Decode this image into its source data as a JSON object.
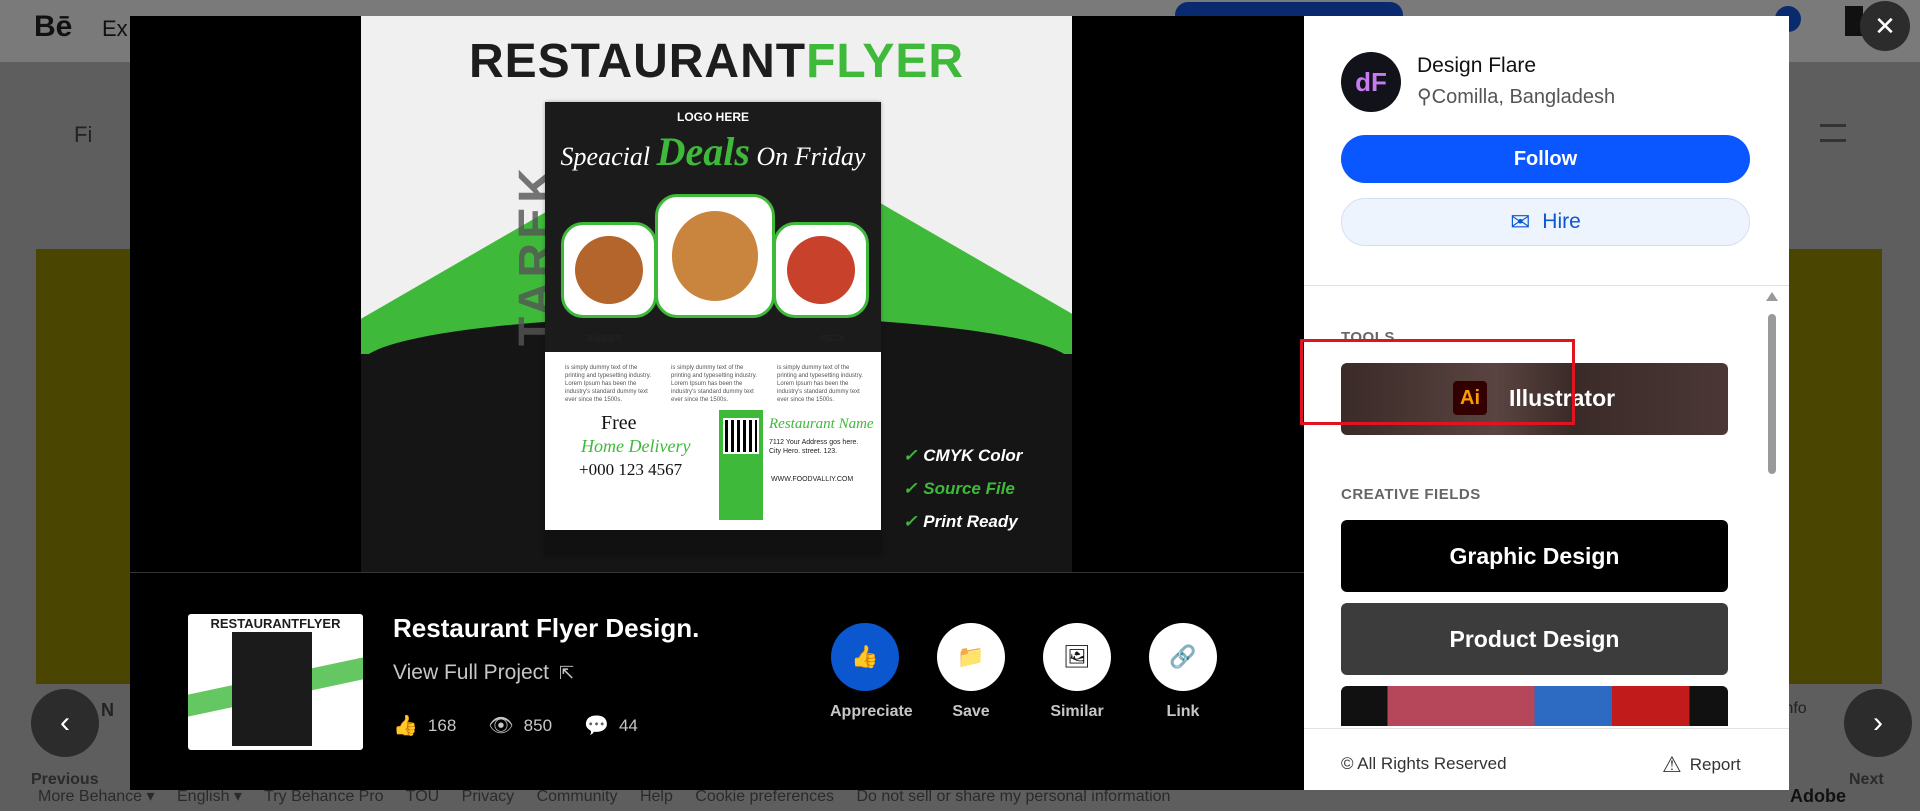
{
  "background": {
    "logo": "Bē",
    "explore": "Ex",
    "filter_label": "Fi",
    "card_label": "d. N",
    "info": "Info",
    "footer_links": [
      "More Behance ▾",
      "English ▾",
      "Try Behance Pro",
      "TOU",
      "Privacy",
      "Community",
      "Help",
      "Cookie preferences",
      "Do not sell or share my personal information"
    ],
    "footer_brand": "Adobe"
  },
  "close_icon": "✕",
  "flyer": {
    "title_part1": "RESTAURANT",
    "title_part2": "FLYER",
    "logo_here": "LOGO HERE",
    "headline_pre": "Speacial",
    "headline_deals": "Deals",
    "headline_post": "On Friday",
    "food_labels": [
      "BURGER",
      "PIZZA"
    ],
    "body_text": "is simply dummy text of the printing and typesetting industry. Lorem Ipsum has been the industry's standard dummy text ever since the 1500s.",
    "free": "Free",
    "home_delivery": "Home Delivery",
    "phone": "+000 123 4567",
    "restaurant_name": "Restaurant Name",
    "address": "7112 Your Address gos here. City Hero. street. 123.",
    "url": "WWW.FOODVALLIY.COM",
    "watermark": "TAREK",
    "features": [
      {
        "text": "CMYK Color",
        "green": false
      },
      {
        "text": "Source File",
        "green": true
      },
      {
        "text": "Print Ready",
        "green": false
      }
    ]
  },
  "project": {
    "thumb_title": "RESTAURANTFLYER",
    "title": "Restaurant Flyer Design.",
    "view_full": "View Full Project",
    "external_icon": "external-link-icon",
    "stats": {
      "appreciations": "168",
      "views": "850",
      "comments": "44"
    },
    "actions": [
      {
        "label": "Appreciate",
        "icon": "thumbs-up-icon"
      },
      {
        "label": "Save",
        "icon": "folder-icon"
      },
      {
        "label": "Similar",
        "icon": "image-icon"
      },
      {
        "label": "Link",
        "icon": "link-icon"
      }
    ]
  },
  "owner": {
    "avatar_initials": "dF",
    "name": "Design Flare",
    "location": "Comilla, Bangladesh",
    "follow_label": "Follow",
    "hire_label": "Hire"
  },
  "tools": {
    "section_label": "TOOLS",
    "items": [
      {
        "name": "Illustrator",
        "badge": "Ai"
      }
    ]
  },
  "creative_fields": {
    "section_label": "CREATIVE FIELDS",
    "items": [
      "Graphic Design",
      "Product Design"
    ]
  },
  "footer": {
    "rights": "© All Rights Reserved",
    "report": "Report"
  },
  "nav": {
    "previous": "Previous",
    "next": "Next"
  },
  "colors": {
    "accent_blue": "#0b57ff",
    "highlight_red": "#e0141e",
    "flyer_green": "#3fb93a"
  }
}
